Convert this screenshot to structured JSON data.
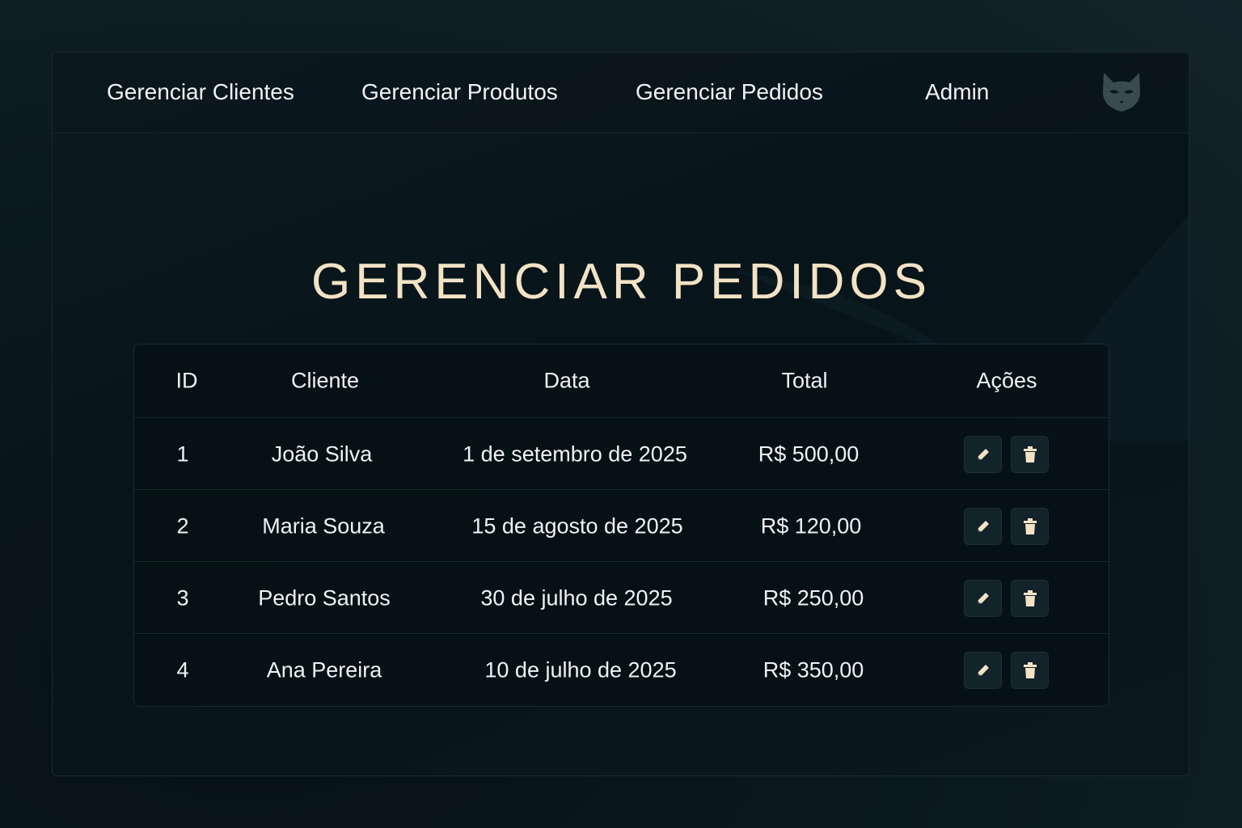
{
  "nav": {
    "items": [
      {
        "label": "Gerenciar Clientes"
      },
      {
        "label": "Gerenciar Produtos"
      },
      {
        "label": "Gerenciar Pedidos"
      },
      {
        "label": "Admin"
      }
    ],
    "logo_icon": "cat-mask-icon"
  },
  "page": {
    "title": "GERENCIAR PEDIDOS"
  },
  "table": {
    "columns": [
      "ID",
      "Cliente",
      "Data",
      "Total",
      "Ações"
    ],
    "rows": [
      {
        "id": "1",
        "cliente": "João Silva",
        "data": "1 de setembro de 2025",
        "total": "R$ 500,00"
      },
      {
        "id": "2",
        "cliente": "Maria Souza",
        "data": "15 de agosto de 2025",
        "total": "R$ 120,00"
      },
      {
        "id": "3",
        "cliente": "Pedro Santos",
        "data": "30 de julho de 2025",
        "total": "R$ 250,00"
      },
      {
        "id": "4",
        "cliente": "Ana Pereira",
        "data": "10 de julho de 2025",
        "total": "R$ 350,00"
      }
    ],
    "action_icons": [
      "pencil-icon",
      "trash-icon"
    ]
  },
  "colors": {
    "accent": "#f3e2c4",
    "background": "#07141a",
    "button_bg": "#13232a"
  }
}
